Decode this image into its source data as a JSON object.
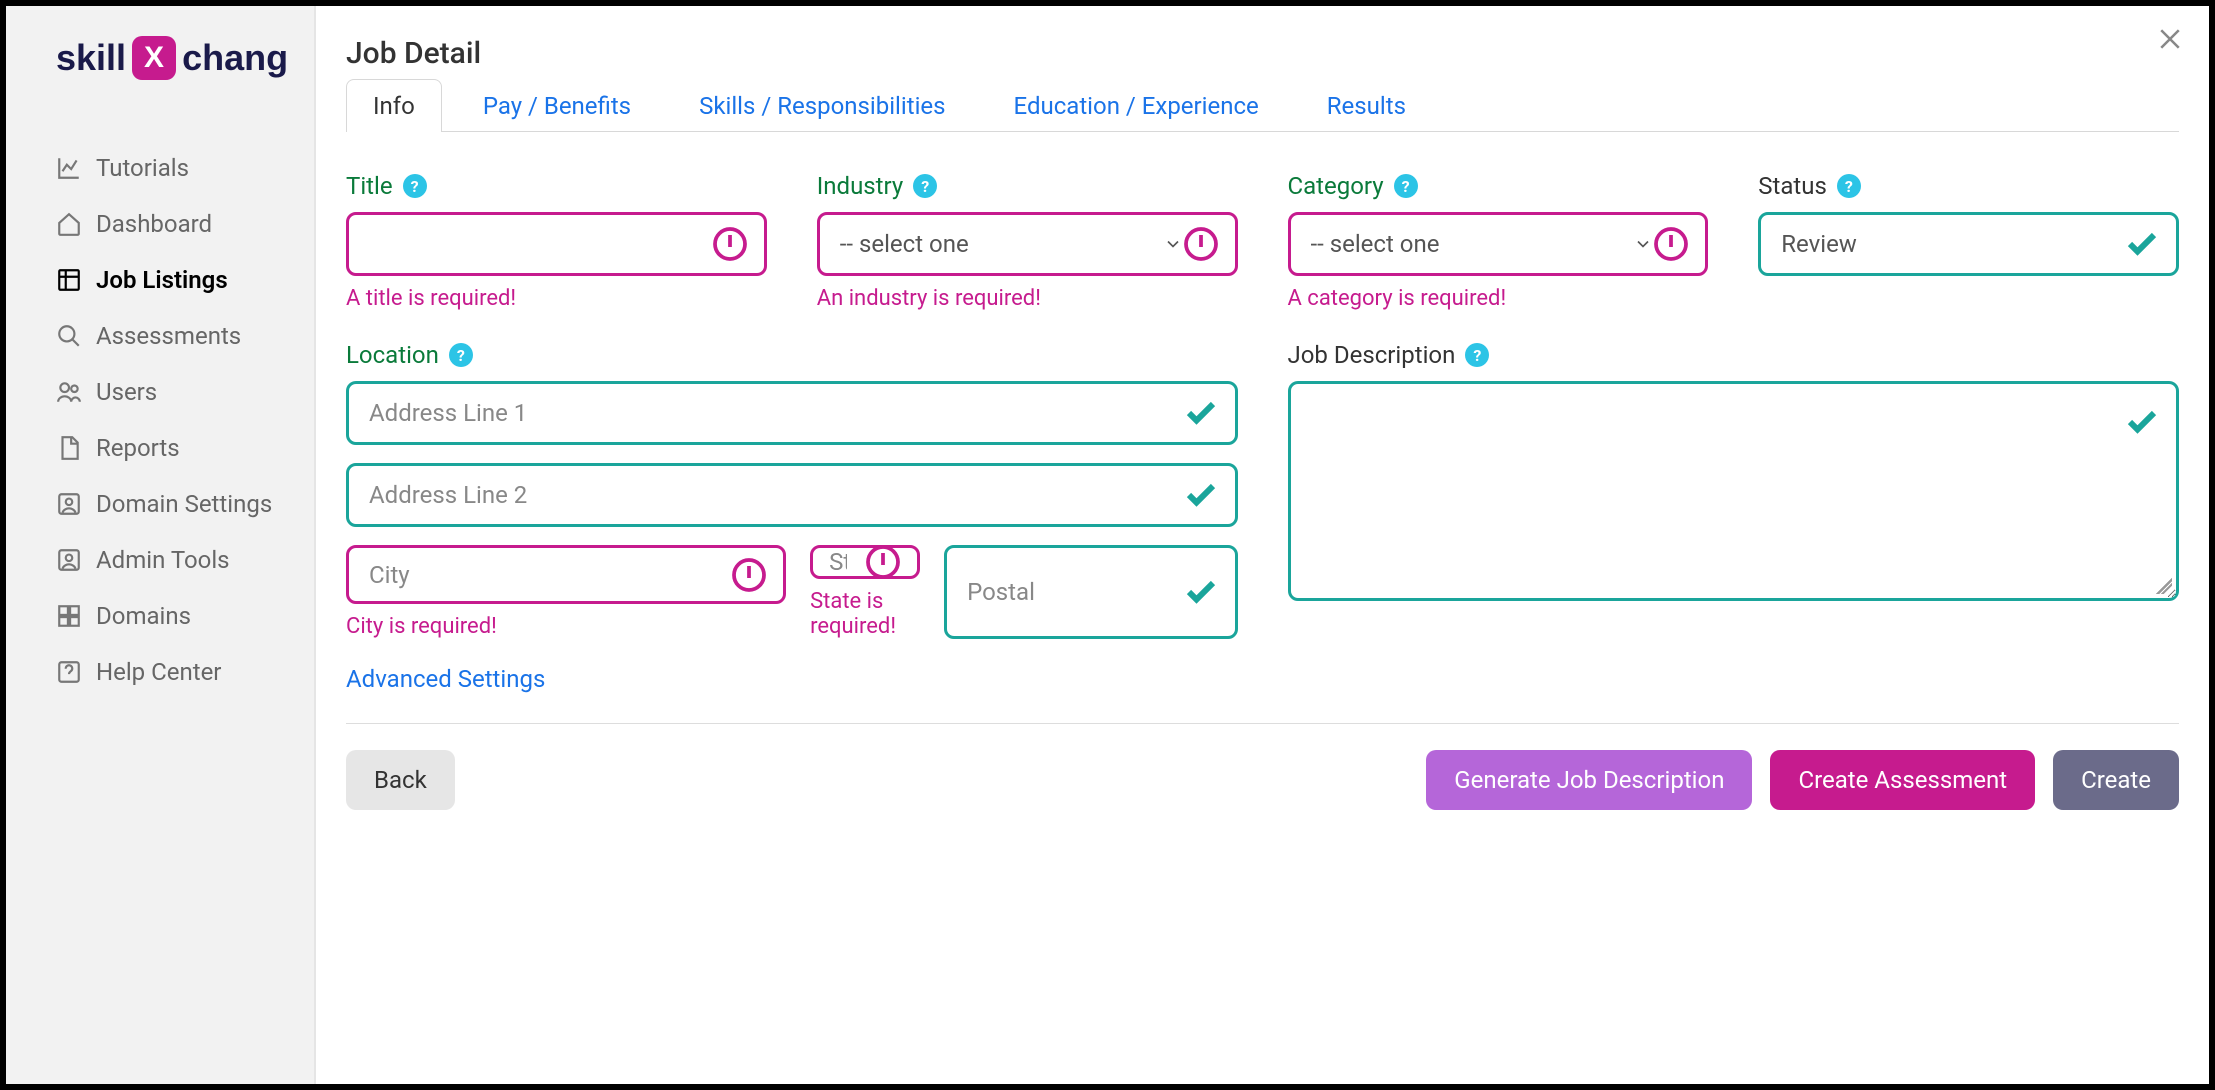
{
  "logo": {
    "part1": "skill",
    "part2": "chang",
    "mark": "X"
  },
  "sidebar": {
    "items": [
      {
        "label": "Tutorials",
        "icon": "chart"
      },
      {
        "label": "Dashboard",
        "icon": "home"
      },
      {
        "label": "Job Listings",
        "icon": "grid",
        "active": true
      },
      {
        "label": "Assessments",
        "icon": "search"
      },
      {
        "label": "Users",
        "icon": "users"
      },
      {
        "label": "Reports",
        "icon": "file"
      },
      {
        "label": "Domain Settings",
        "icon": "person-box"
      },
      {
        "label": "Admin Tools",
        "icon": "person-box"
      },
      {
        "label": "Domains",
        "icon": "grid4"
      },
      {
        "label": "Help Center",
        "icon": "help"
      }
    ]
  },
  "page": {
    "title": "Job Detail"
  },
  "tabs": [
    {
      "label": "Info",
      "active": true
    },
    {
      "label": "Pay / Benefits"
    },
    {
      "label": "Skills / Responsibilities"
    },
    {
      "label": "Education / Experience"
    },
    {
      "label": "Results"
    }
  ],
  "fields": {
    "title": {
      "label": "Title",
      "error": "A title is required!",
      "value": ""
    },
    "industry": {
      "label": "Industry",
      "placeholder": "-- select one --",
      "error": "An industry is required!"
    },
    "category": {
      "label": "Category",
      "placeholder": "-- select one --",
      "error": "A category is required!"
    },
    "status": {
      "label": "Status",
      "value": "Review"
    },
    "location": {
      "label": "Location",
      "addr1_placeholder": "Address Line 1",
      "addr2_placeholder": "Address Line 2",
      "city_placeholder": "City",
      "city_error": "City is required!",
      "state_placeholder": "State",
      "state_error": "State is required!",
      "postal_placeholder": "Postal"
    },
    "description": {
      "label": "Job Description",
      "value": ""
    }
  },
  "advanced_link": "Advanced Settings",
  "footer": {
    "back": "Back",
    "generate": "Generate Job Description",
    "create_assessment": "Create Assessment",
    "create": "Create"
  }
}
